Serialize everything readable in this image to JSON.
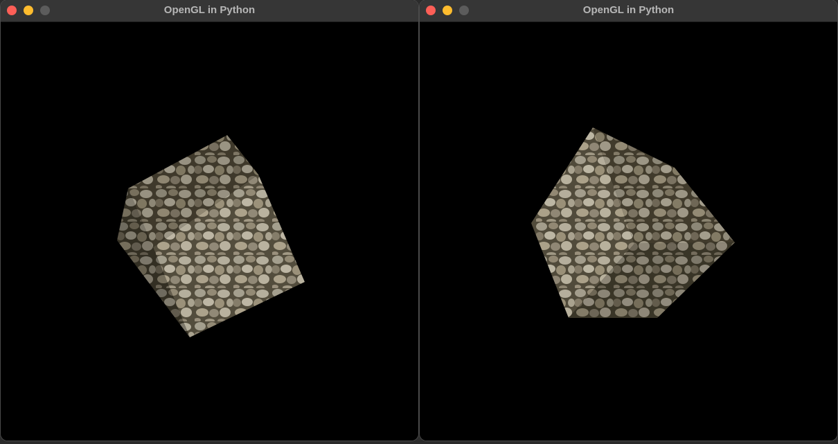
{
  "windows": [
    {
      "title": "OpenGL in Python",
      "traffic_lights": {
        "close": "#fe5f57",
        "minimize": "#febc2e",
        "zoom": "#5c5c5c"
      },
      "scene": {
        "object": "textured cube",
        "texture": "cobblestone",
        "background": "#000000"
      }
    },
    {
      "title": "OpenGL in Python",
      "traffic_lights": {
        "close": "#fe5f57",
        "minimize": "#febc2e",
        "zoom": "#5c5c5c"
      },
      "scene": {
        "object": "textured cube",
        "texture": "cobblestone",
        "background": "#000000"
      }
    }
  ]
}
